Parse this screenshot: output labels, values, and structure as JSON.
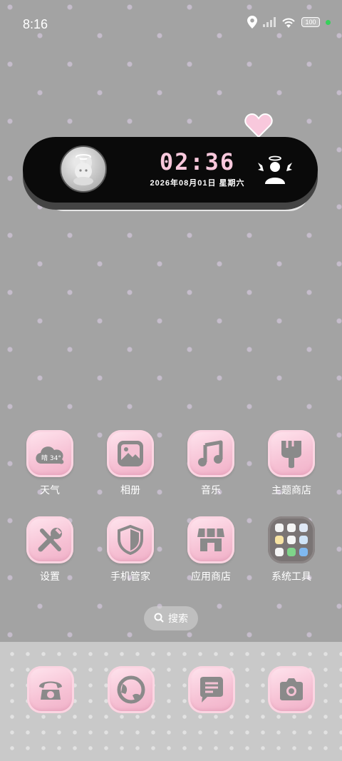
{
  "status_bar": {
    "time": "8:16",
    "battery": "100"
  },
  "widget": {
    "time": "02:36",
    "date": "2026年08月01日 星期六"
  },
  "apps": [
    {
      "label": "天气",
      "icon": "weather-icon",
      "weather_text": "晴 34°"
    },
    {
      "label": "相册",
      "icon": "gallery-icon"
    },
    {
      "label": "音乐",
      "icon": "music-icon"
    },
    {
      "label": "主题商店",
      "icon": "theme-store-icon"
    },
    {
      "label": "设置",
      "icon": "settings-icon"
    },
    {
      "label": "手机管家",
      "icon": "phone-manager-icon"
    },
    {
      "label": "应用商店",
      "icon": "app-store-icon"
    },
    {
      "label": "系统工具",
      "icon": "system-tools-folder-icon"
    }
  ],
  "search": {
    "label": "搜索"
  },
  "dock": [
    {
      "icon": "phone-icon"
    },
    {
      "icon": "browser-icon"
    },
    {
      "icon": "messages-icon"
    },
    {
      "icon": "camera-icon"
    }
  ],
  "colors": {
    "accent_pink": "#f6c1d4",
    "icon_glyph": "#8a8a8a",
    "background": "#a3a3a3"
  }
}
